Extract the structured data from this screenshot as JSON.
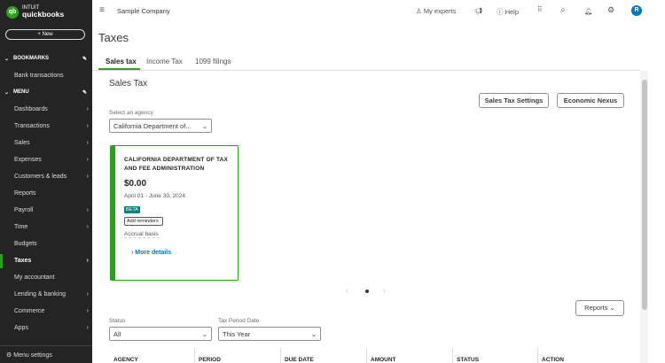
{
  "brand": {
    "top": "INTUIT",
    "name": "quickbooks"
  },
  "sidebar": {
    "new_label": "+ New",
    "bookmarks": "BOOKMARKS",
    "bookmark_items": [
      "Bank transactions"
    ],
    "menu": "MENU",
    "items": [
      {
        "label": "Dashboards",
        "chevron": true
      },
      {
        "label": "Transactions",
        "chevron": true
      },
      {
        "label": "Sales",
        "chevron": true
      },
      {
        "label": "Expenses",
        "chevron": true
      },
      {
        "label": "Customers & leads",
        "chevron": true
      },
      {
        "label": "Reports",
        "chevron": false
      },
      {
        "label": "Payroll",
        "chevron": true
      },
      {
        "label": "Time",
        "chevron": true
      },
      {
        "label": "Budgets",
        "chevron": false
      },
      {
        "label": "Taxes",
        "chevron": true,
        "active": true
      },
      {
        "label": "My accountant",
        "chevron": false
      },
      {
        "label": "Lending & banking",
        "chevron": true
      },
      {
        "label": "Commerce",
        "chevron": true
      },
      {
        "label": "Apps",
        "chevron": true
      }
    ],
    "menu_settings": "Menu settings"
  },
  "topbar": {
    "company": "Sample Company",
    "my_experts": "My experts",
    "help": "Help",
    "avatar": "R"
  },
  "page": {
    "title": "Taxes",
    "tabs": [
      "Sales tax",
      "Income Tax",
      "1099 filings"
    ]
  },
  "sales_tax": {
    "heading": "Sales Tax",
    "settings_btn": "Sales Tax Settings",
    "nexus_btn": "Economic Nexus",
    "agency_label": "Select an agency",
    "agency_value": "California Department of...",
    "card": {
      "name": "CALIFORNIA DEPARTMENT OF TAX AND FEE ADMINISTRATION",
      "amount": "$0.00",
      "period": "April 01 - June 30, 2024",
      "badge": "BETA",
      "reminders": "Add reminders",
      "basis": "Accrual basis",
      "more": "More details"
    },
    "reports_btn": "Reports",
    "status_label": "Status",
    "status_value": "All",
    "period_label": "Tax Period Date",
    "period_value": "This Year",
    "columns": [
      "AGENCY",
      "PERIOD",
      "DUE DATE",
      "AMOUNT",
      "STATUS",
      "ACTION"
    ]
  },
  "colors": {
    "accent": "#2ca01c",
    "sidebar": "#242424",
    "link": "#0077c5"
  }
}
